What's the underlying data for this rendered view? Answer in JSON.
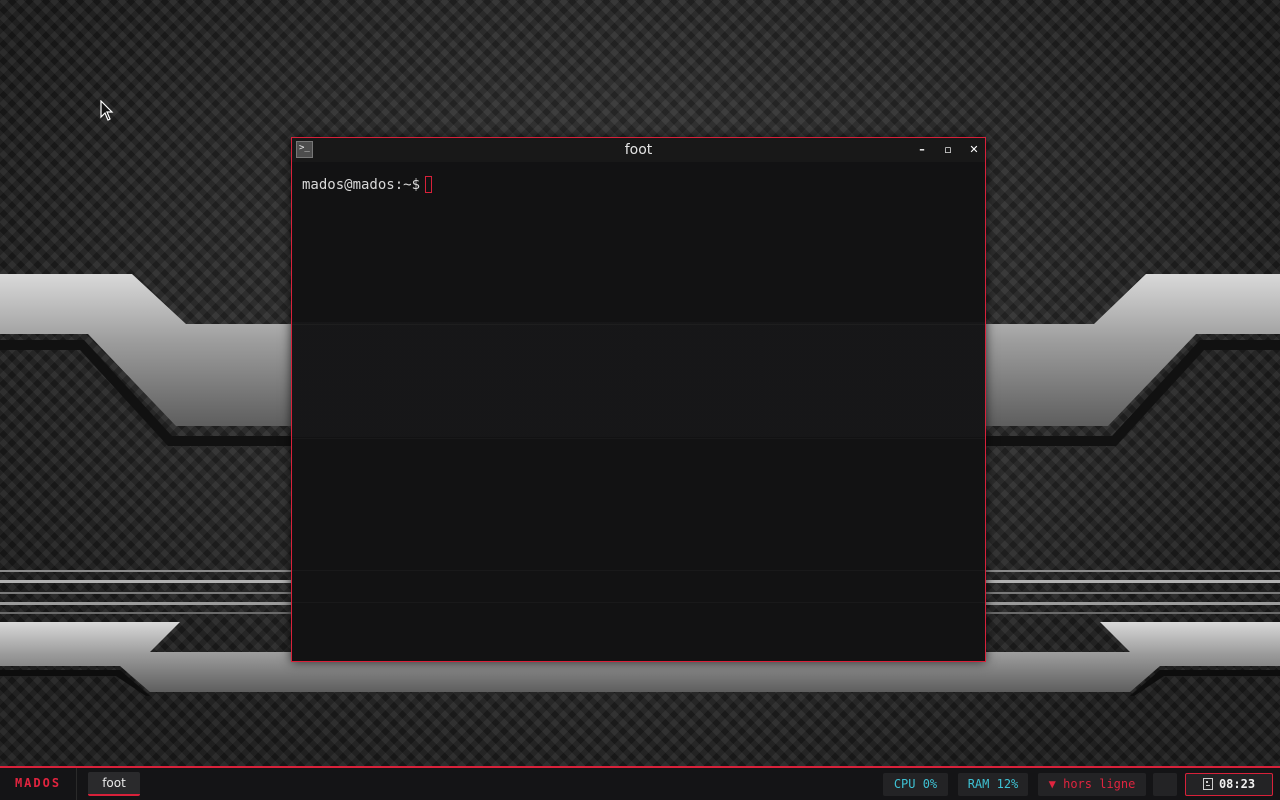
{
  "window": {
    "title": "foot",
    "app_icon": "terminal-icon",
    "controls": {
      "minimize": "minimize-icon",
      "maximize": "maximize-icon",
      "close": "close-icon"
    }
  },
  "terminal": {
    "prompt": "mados@mados:~$"
  },
  "taskbar": {
    "brand": "MADOS",
    "tasks": [
      {
        "label": "foot",
        "active": true
      }
    ],
    "modules": {
      "cpu": "CPU 0%",
      "ram": "RAM 12%",
      "network": "▼ hors ligne",
      "clock": "08:23",
      "clock_icon": "calendar-icon"
    }
  },
  "colors": {
    "accent": "#d8213a",
    "brand": "#e0243f",
    "cyan": "#3ec1d3",
    "panel": "#141416"
  }
}
